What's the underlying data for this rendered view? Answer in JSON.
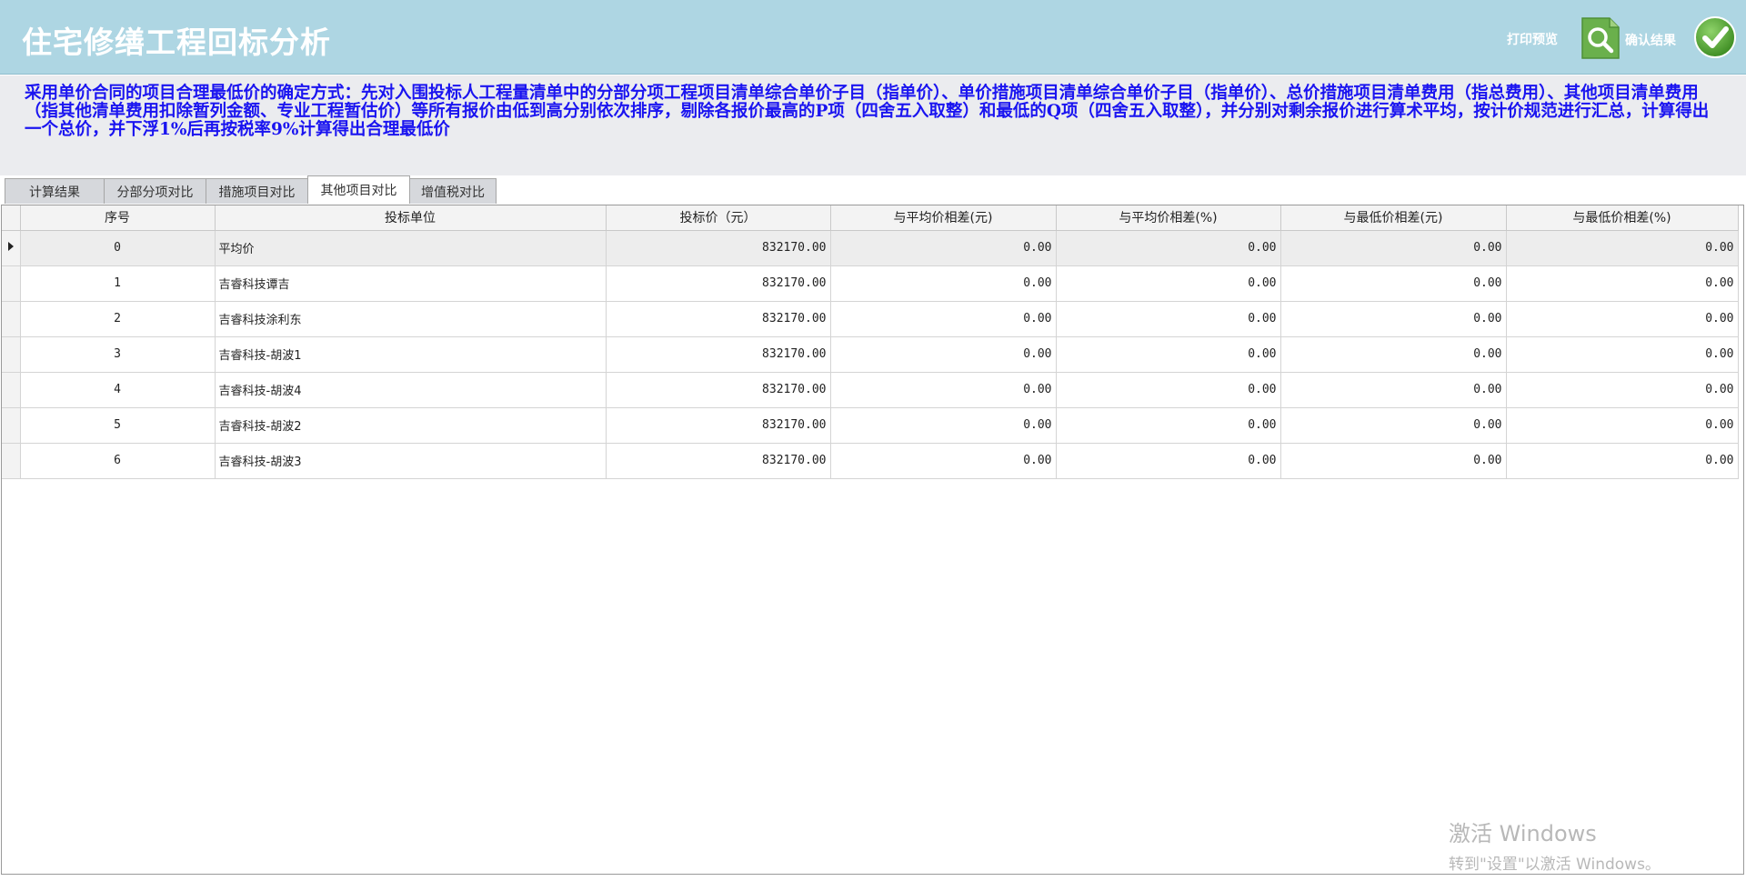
{
  "header": {
    "title": "住宅修缮工程回标分析",
    "print_label": "打印预览",
    "confirm_label": "确认结果",
    "colors": {
      "header_bg": "#aed6e3",
      "print_icon": "#6ab04c",
      "confirm_icon": "#55a43a"
    }
  },
  "description": "采用单价合同的项目合理最低价的确定方式：先对入围投标人工程量清单中的分部分项工程项目清单综合单价子目（指单价）、单价措施项目清单综合单价子目（指单价）、总价措施项目清单费用（指总费用）、其他项目清单费用（指其他清单费用扣除暂列金额、专业工程暂估价）等所有报价由低到高分别依次排序，剔除各报价最高的P项（四舍五入取整）和最低的Q项（四舍五入取整），并分别对剩余报价进行算术平均，按计价规范进行汇总，计算得出一个总价，并下浮1%后再按税率9%计算得出合理最低价",
  "tabs": [
    {
      "label": "计算结果"
    },
    {
      "label": "分部分项对比"
    },
    {
      "label": "措施项目对比"
    },
    {
      "label": "其他项目对比",
      "active": true
    },
    {
      "label": "增值税对比"
    }
  ],
  "table": {
    "columns": [
      "序号",
      "投标单位",
      "投标价（元）",
      "与平均价相差(元)",
      "与平均价相差(%)",
      "与最低价相差(元)",
      "与最低价相差(%)"
    ],
    "rows": [
      [
        "0",
        "平均价",
        "832170.00",
        "0.00",
        "0.00",
        "0.00",
        "0.00"
      ],
      [
        "1",
        "吉睿科技谭吉",
        "832170.00",
        "0.00",
        "0.00",
        "0.00",
        "0.00"
      ],
      [
        "2",
        "吉睿科技涂利东",
        "832170.00",
        "0.00",
        "0.00",
        "0.00",
        "0.00"
      ],
      [
        "3",
        "吉睿科技-胡波1",
        "832170.00",
        "0.00",
        "0.00",
        "0.00",
        "0.00"
      ],
      [
        "4",
        "吉睿科技-胡波4",
        "832170.00",
        "0.00",
        "0.00",
        "0.00",
        "0.00"
      ],
      [
        "5",
        "吉睿科技-胡波2",
        "832170.00",
        "0.00",
        "0.00",
        "0.00",
        "0.00"
      ],
      [
        "6",
        "吉睿科技-胡波3",
        "832170.00",
        "0.00",
        "0.00",
        "0.00",
        "0.00"
      ]
    ],
    "selected_row": 0
  },
  "watermark": {
    "line1": "激活 Windows",
    "line2": "转到\"设置\"以激活 Windows。"
  }
}
